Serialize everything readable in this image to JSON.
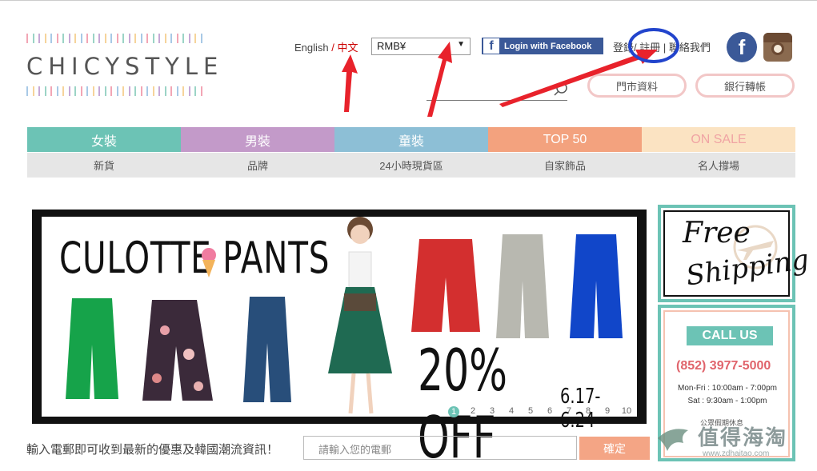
{
  "header": {
    "logo_text": "CHICYSTYLE",
    "lang_english": "English",
    "lang_sep": " / ",
    "lang_chinese": "中文",
    "currency_value": "RMB¥",
    "fb_login_label": "Login with Facebook",
    "login_label": "登錄",
    "register_label": "/ 註冊",
    "sep": " | ",
    "contact_label": "聯絡我們",
    "store_info_label": "門市資料",
    "bank_transfer_label": "銀行轉帳"
  },
  "nav": {
    "items": [
      {
        "label": "女裝",
        "color": "#6cc3b5"
      },
      {
        "label": "男裝",
        "color": "#c39ac9"
      },
      {
        "label": "童裝",
        "color": "#8dbfd6"
      },
      {
        "label": "TOP 50",
        "color": "#f3a27e"
      },
      {
        "label": "ON SALE",
        "color": "#fbe3c2"
      }
    ],
    "sub_items": [
      "新貨",
      "品牌",
      "24小時現貨區",
      "自家飾品",
      "名人撐場"
    ]
  },
  "banner": {
    "title": "CULOTTE PANTS",
    "discount": "20% OFF",
    "dates": "6.17-6.24",
    "pages": [
      "1",
      "2",
      "3",
      "4",
      "5",
      "6",
      "7",
      "8",
      "9",
      "10"
    ],
    "active_page": "1"
  },
  "side": {
    "free_line1": "Free",
    "free_line2": "Shipping",
    "call_us": "CALL US",
    "phone": "(852) 3977-5000",
    "hours_weekday": "Mon-Fri : 10:00am - 7:00pm",
    "hours_sat": "Sat : 9:30am - 1:00pm",
    "holiday_note": "公眾假期休息"
  },
  "newsletter": {
    "label": "輸入電郵即可收到最新的優惠及韓國潮流資訊！",
    "placeholder": "請輸入您的電郵",
    "button": "確定"
  },
  "watermark": {
    "text": "值得海淘",
    "url": "www.zdhaitao.com"
  },
  "colors": {
    "accent_teal": "#6cc3b5",
    "annotation_red": "#e8222b",
    "annotation_blue": "#2244cc"
  }
}
